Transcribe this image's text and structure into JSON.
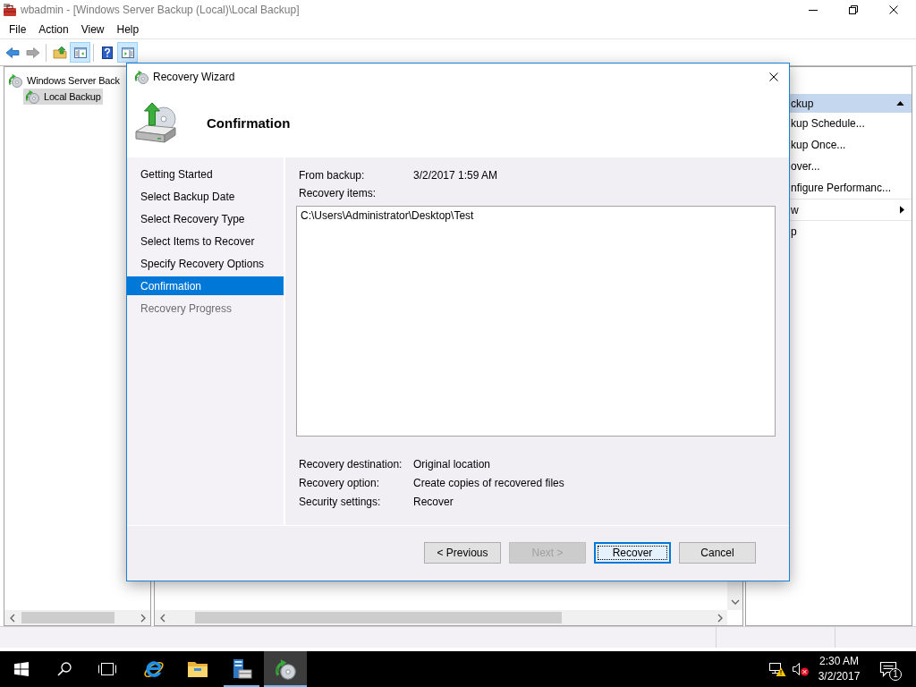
{
  "window": {
    "title": "wbadmin - [Windows Server Backup (Local)\\Local Backup]"
  },
  "menu_bar": [
    {
      "label": "File"
    },
    {
      "label": "Action"
    },
    {
      "label": "View"
    },
    {
      "label": "Help"
    }
  ],
  "toolbar": {
    "groups": [
      {
        "buttons": [
          {
            "kind": "back",
            "pressed": false,
            "disabled": false
          },
          {
            "kind": "forward",
            "pressed": false,
            "disabled": true
          }
        ]
      },
      {
        "buttons": [
          {
            "kind": "up-folder",
            "pressed": false,
            "disabled": false
          },
          {
            "kind": "console-tree",
            "pressed": true,
            "disabled": false
          }
        ]
      },
      {
        "buttons": [
          {
            "kind": "help",
            "pressed": false,
            "disabled": false
          },
          {
            "kind": "action-pane",
            "pressed": true,
            "disabled": false
          }
        ]
      }
    ]
  },
  "console_tree": [
    {
      "label": "Windows Server Back",
      "selected": false,
      "children": [
        {
          "label": "Local Backup",
          "selected": true
        }
      ]
    }
  ],
  "actions_pane": {
    "header": "ckup",
    "expanded": true,
    "items": [
      {
        "label": "kup Schedule...",
        "kind": "action",
        "separator_before": false
      },
      {
        "label": "kup Once...",
        "kind": "action",
        "separator_before": false
      },
      {
        "label": "over...",
        "kind": "action",
        "separator_before": false
      },
      {
        "label": "nfigure Performanc...",
        "kind": "action",
        "separator_before": false
      },
      {
        "label": "w",
        "kind": "submenu",
        "separator_before": true
      },
      {
        "label": "p",
        "kind": "action",
        "separator_before": true
      }
    ]
  },
  "wizard": {
    "title": "Recovery Wizard",
    "heading": "Confirmation",
    "steps": [
      {
        "label": "Getting Started",
        "selected": false,
        "disabled": false
      },
      {
        "label": "Select Backup Date",
        "selected": false,
        "disabled": false
      },
      {
        "label": "Select Recovery Type",
        "selected": false,
        "disabled": false
      },
      {
        "label": "Select Items to Recover",
        "selected": false,
        "disabled": false
      },
      {
        "label": "Specify Recovery Options",
        "selected": false,
        "disabled": false
      },
      {
        "label": "Confirmation",
        "selected": true,
        "disabled": false
      },
      {
        "label": "Recovery Progress",
        "selected": false,
        "disabled": true
      }
    ],
    "from_backup": {
      "label": "From backup:",
      "value": "3/2/2017 1:59 AM"
    },
    "recovery_items": {
      "label": "Recovery items:",
      "items": [
        "C:\\Users\\Administrator\\Desktop\\Test"
      ]
    },
    "details": [
      {
        "label": "Recovery destination:",
        "value": "Original location"
      },
      {
        "label": "Recovery option:",
        "value": "Create copies of recovered files"
      },
      {
        "label": "Security settings:",
        "value": "Recover"
      }
    ],
    "buttons": [
      {
        "label": "< Previous",
        "disabled": false,
        "focused": false
      },
      {
        "label": "Next >",
        "disabled": true,
        "focused": false
      },
      {
        "label": "Recover",
        "disabled": false,
        "focused": true
      },
      {
        "label": "Cancel",
        "disabled": false,
        "focused": false
      }
    ]
  },
  "taskbar": {
    "buttons": [
      {
        "kind": "start"
      },
      {
        "kind": "search"
      },
      {
        "kind": "task-view"
      }
    ],
    "apps": [
      {
        "kind": "browser",
        "running": false,
        "active": false
      },
      {
        "kind": "file-explorer",
        "running": false,
        "active": false
      },
      {
        "kind": "server-manager",
        "running": true,
        "active": false
      },
      {
        "kind": "backup",
        "running": true,
        "active": true
      }
    ],
    "clock": {
      "time": "2:30 AM",
      "date": "3/2/2017"
    },
    "notification_count": "1"
  }
}
